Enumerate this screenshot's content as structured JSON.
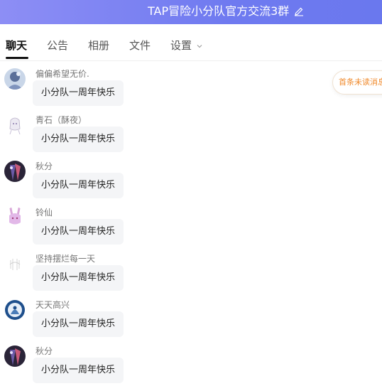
{
  "header": {
    "title": "TAP冒险小分队官方交流3群",
    "bg_color": "#7a80f2",
    "icon": "edit-icon"
  },
  "tabs": [
    {
      "label": "聊天",
      "active": true
    },
    {
      "label": "公告",
      "active": false
    },
    {
      "label": "相册",
      "active": false
    },
    {
      "label": "文件",
      "active": false
    },
    {
      "label": "设置",
      "active": false,
      "icon": "chevron-down-icon"
    }
  ],
  "unread_button": {
    "label": "首条未读消息"
  },
  "messages": [
    {
      "sender": "偏偏希望无价.",
      "text": "小分队一周年快乐",
      "avatar": "avatar-blue-character"
    },
    {
      "sender": "青石（酥夜）",
      "text": "小分队一周年快乐",
      "avatar": "avatar-white-anime-girl"
    },
    {
      "sender": "秋分",
      "text": "小分队一周年快乐",
      "avatar": "avatar-dark-purple"
    },
    {
      "sender": "铃仙",
      "text": "小分队一周年快乐",
      "avatar": "avatar-pink-bunny-girl"
    },
    {
      "sender": "坚持摆烂每一天",
      "text": "小分队一周年快乐",
      "avatar": "avatar-white-sketch"
    },
    {
      "sender": "天天高兴",
      "text": "小分队一周年快乐",
      "avatar": "avatar-blue-badge"
    },
    {
      "sender": "秋分",
      "text": "小分队一周年快乐",
      "avatar": "avatar-dark-purple"
    }
  ],
  "colors": {
    "accent_unread": "#f08a2c",
    "bubble_bg": "#f4f5f7"
  }
}
